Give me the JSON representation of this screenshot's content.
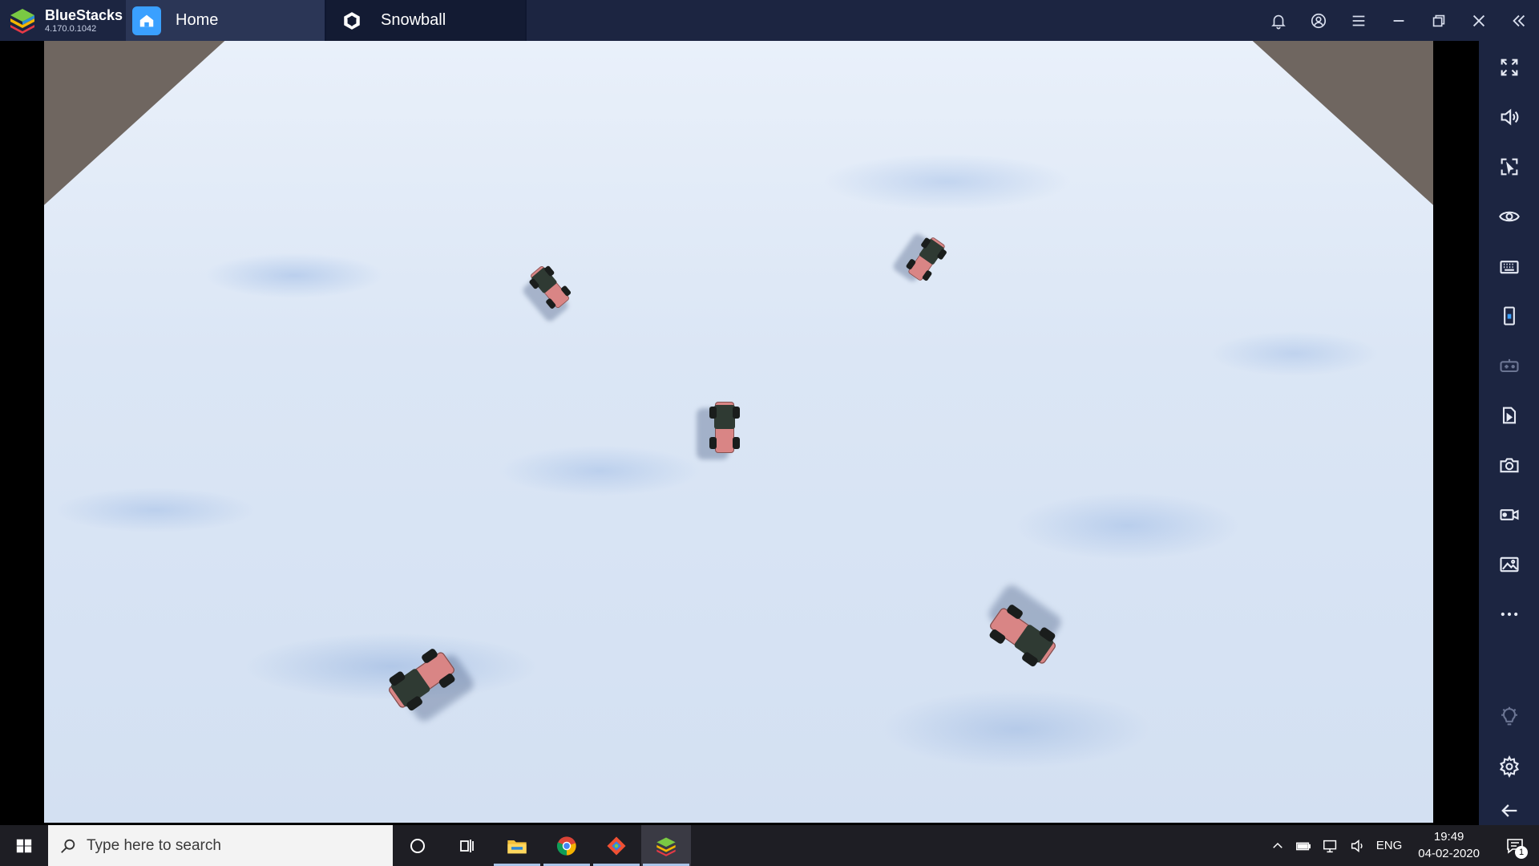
{
  "app": {
    "name": "BlueStacks",
    "version": "4.170.0.1042"
  },
  "tabs": [
    {
      "label": "Home",
      "icon": "home-icon",
      "active": false
    },
    {
      "label": "Snowball",
      "icon": "unity-icon",
      "active": true
    }
  ],
  "title_controls": [
    "bell-icon",
    "account-icon",
    "menu-icon",
    "minimize-icon",
    "restore-icon",
    "close-icon",
    "collapse-sidebar-icon"
  ],
  "sidebar": {
    "buttons": [
      "fullscreen-icon",
      "volume-icon",
      "lock-cursor-icon",
      "eye-icon",
      "keyboard-icon",
      "rotate-device-icon",
      "gamepad-icon",
      "install-apk-icon",
      "camera-icon",
      "record-icon",
      "media-folder-icon",
      "more-icon",
      "brightness-icon",
      "settings-icon",
      "back-icon"
    ]
  },
  "taskbar": {
    "search_placeholder": "Type here to search",
    "apps": [
      "cortana-icon",
      "task-view-icon",
      "file-explorer-icon",
      "chrome-icon",
      "git-icon",
      "bluestacks-icon"
    ],
    "language": "ENG",
    "time": "19:49",
    "date": "04-02-2020",
    "notification_count": "1"
  },
  "colors": {
    "titlebar": "#1c2541",
    "snow": "#dbe6f5",
    "vehicle_body": "#d98585",
    "vehicle_cab": "#2f3a33"
  }
}
